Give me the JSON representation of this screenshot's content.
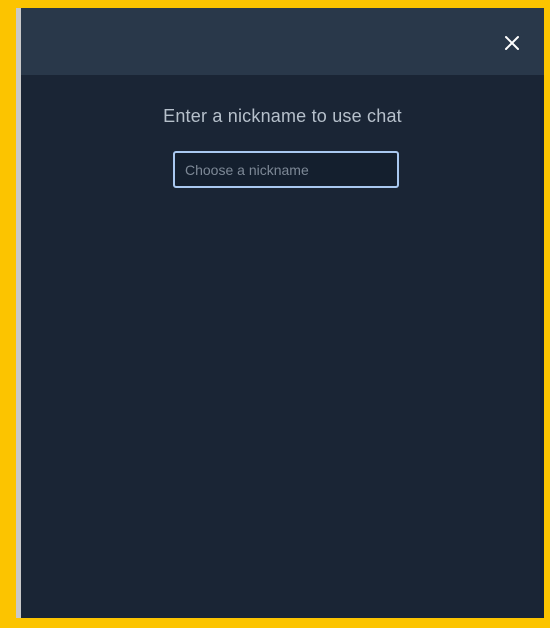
{
  "colors": {
    "frame_border": "#fcc400",
    "panel_background": "#1a2535",
    "header_background": "#29384a",
    "prompt_text": "#b6c0cb",
    "input_border": "#a9c8f0"
  },
  "header": {
    "close_icon": "close-icon"
  },
  "chat_login": {
    "prompt": "Enter a nickname to use chat",
    "nickname_placeholder": "Choose a nickname",
    "nickname_value": ""
  }
}
